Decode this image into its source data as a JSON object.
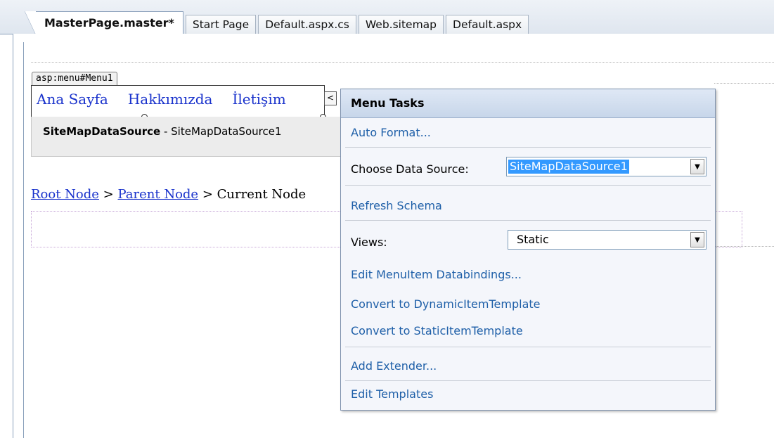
{
  "tabs": [
    {
      "label": "MasterPage.master*",
      "active": true
    },
    {
      "label": "Start Page",
      "active": false
    },
    {
      "label": "Default.aspx.cs",
      "active": false
    },
    {
      "label": "Web.sitemap",
      "active": false
    },
    {
      "label": "Default.aspx",
      "active": false
    }
  ],
  "designer": {
    "menu_tag": "asp:menu#Menu1",
    "menu_items": [
      "Ana Sayfa",
      "Hakkımızda",
      "İletişim"
    ],
    "smart_tag_glyph": "<",
    "sitemap_source_name": "SiteMapDataSource",
    "sitemap_source_suffix": " - SiteMapDataSource1",
    "breadcrumb": {
      "root": "Root Node",
      "sep1": " > ",
      "parent": "Parent Node",
      "sep2": " > ",
      "current": "Current Node"
    }
  },
  "menu_tasks": {
    "title": "Menu Tasks",
    "auto_format": "Auto Format...",
    "choose_data_source_label": "Choose Data Source:",
    "choose_data_source_value": "SiteMapDataSource1",
    "refresh_schema": "Refresh Schema",
    "views_label": "Views:",
    "views_value": "Static",
    "edit_databindings": "Edit MenuItem Databindings...",
    "convert_dynamic": "Convert to DynamicItemTemplate",
    "convert_static": "Convert to StaticItemTemplate",
    "add_extender": "Add Extender...",
    "edit_templates": "Edit Templates",
    "dropdown_glyph": "▼"
  },
  "colors": {
    "link": "#1e5fa8",
    "menu_link": "#1a33cc",
    "selection": "#3399ff",
    "panel_header": "#c7d6ea"
  }
}
